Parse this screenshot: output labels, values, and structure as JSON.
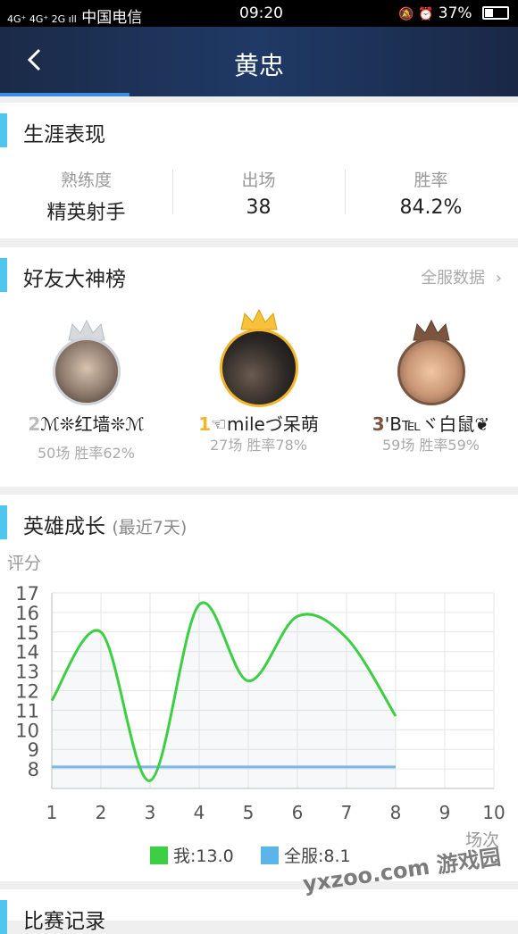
{
  "status_bar": {
    "signal": "4G⁺ 4G⁺ 2G ıll",
    "carrier": "中国电信",
    "time": "09:20",
    "icons": "🔕 ⏰",
    "battery": "37%"
  },
  "header": {
    "back_icon": "chevron-left-icon",
    "title": "黄忠"
  },
  "career": {
    "title": "生涯表现",
    "stats": [
      {
        "label": "熟练度",
        "value": "精英射手"
      },
      {
        "label": "出场",
        "value": "38"
      },
      {
        "label": "胜率",
        "value": "84.2%"
      }
    ]
  },
  "friends": {
    "title": "好友大神榜",
    "all_link": "全服数据",
    "items": [
      {
        "rank": "2",
        "name": "ℳ❊红墙❊ℳ",
        "stat": "50场 胜率62%",
        "crown_color": "#cfd3d8"
      },
      {
        "rank": "1",
        "name": "☜mileづ呆萌",
        "stat": "27场 胜率78%",
        "crown_color": "#f2b52a"
      },
      {
        "rank": "3",
        "name": "'B℡ヾ白鼠❦",
        "stat": "59场 胜率59%",
        "crown_color": "#7a5540"
      }
    ]
  },
  "growth": {
    "title": "英雄成长",
    "subtitle": "(最近7天)",
    "y_axis_label": "评分",
    "x_axis_label": "场次",
    "legend": [
      {
        "label": "我:13.0",
        "color": "#3ccf43"
      },
      {
        "label": "全服:8.1",
        "color": "#5ab6ea"
      }
    ]
  },
  "chart_data": {
    "type": "line",
    "x": [
      1,
      2,
      3,
      4,
      5,
      6,
      7,
      8
    ],
    "xlim": [
      1,
      10
    ],
    "ylim": [
      7,
      17
    ],
    "x_ticks": [
      "1",
      "2",
      "3",
      "4",
      "5",
      "6",
      "7",
      "8",
      "9",
      "10"
    ],
    "y_ticks": [
      "8",
      "9",
      "10",
      "11",
      "12",
      "13",
      "14",
      "15",
      "16",
      "17"
    ],
    "series": [
      {
        "name": "我",
        "values": [
          11.5,
          15.0,
          7.4,
          16.4,
          12.5,
          15.8,
          14.7,
          10.7
        ],
        "color": "#3ccf43"
      },
      {
        "name": "全服",
        "values": [
          8.1,
          8.1,
          8.1,
          8.1,
          8.1,
          8.1,
          8.1,
          8.1
        ],
        "color": "#7ab8e8"
      }
    ],
    "grid": true
  },
  "matches": {
    "title": "比赛记录"
  },
  "watermark": "yxzoo.com 游戏园"
}
